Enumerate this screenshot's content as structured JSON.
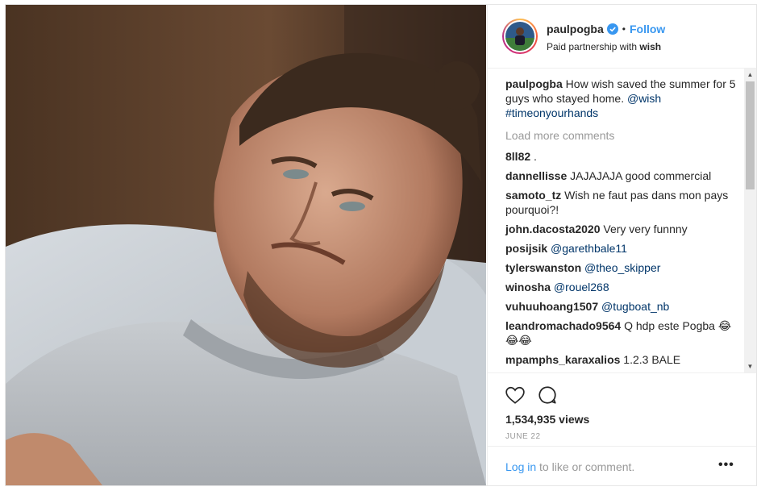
{
  "header": {
    "username": "paulpogba",
    "separator": "•",
    "follow_label": "Follow",
    "partnership_prefix": "Paid partnership with ",
    "partner": "wish",
    "verified_icon": "verified-badge-icon",
    "accent_color": "#3897f0"
  },
  "caption": {
    "username": "paulpogba",
    "text": "How wish saved the summer for 5 guys who stayed home.",
    "mention": "@wish",
    "hashtag": "#timeonyourhands"
  },
  "load_more": "Load more comments",
  "comments": [
    {
      "user": "8ll82",
      "text": ".",
      "mention": ""
    },
    {
      "user": "dannellisse",
      "text": "JAJAJAJA good commercial",
      "mention": ""
    },
    {
      "user": "samoto_tz",
      "text": "Wish ne faut pas dans mon pays pourquoi?!",
      "mention": ""
    },
    {
      "user": "john.dacosta2020",
      "text": "Very very funnny",
      "mention": ""
    },
    {
      "user": "posijsik",
      "text": "",
      "mention": "@garethbale11"
    },
    {
      "user": "tylerswanston",
      "text": "",
      "mention": "@theo_skipper"
    },
    {
      "user": "winosha",
      "text": "",
      "mention": "@rouel268"
    },
    {
      "user": "vuhuuhoang1507",
      "text": "",
      "mention": "@tugboat_nb"
    },
    {
      "user": "leandromachado9564",
      "text": "Q hdp este Pogba 😂😂😂",
      "mention": ""
    },
    {
      "user": "mpamphs_karaxalios",
      "text": "1.2.3 BALE",
      "mention": ""
    }
  ],
  "stats": {
    "views": "1,534,935 views",
    "date": "JUNE 22"
  },
  "footer": {
    "login_link": "Log in",
    "login_rest": " to like or comment.",
    "more_label": "•••"
  }
}
